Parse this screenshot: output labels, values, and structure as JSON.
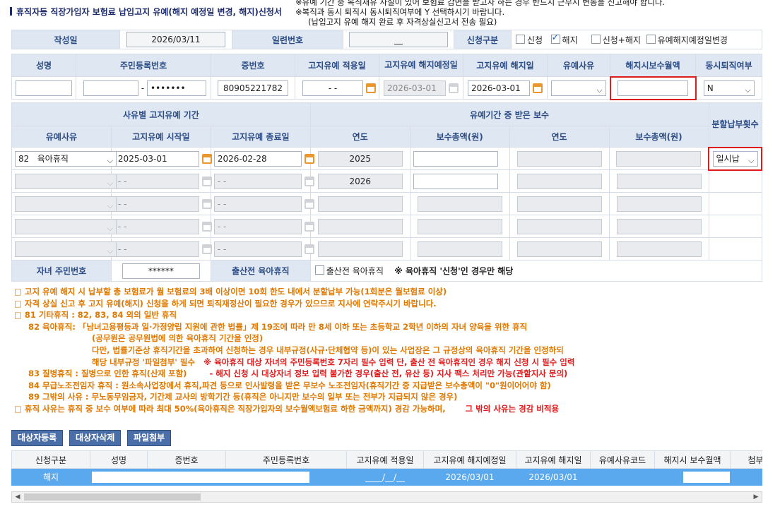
{
  "header": {
    "title": "휴직자등 직장가입자 보험료 납입고지 유예(해지 예정일 변경, 해지)신청서",
    "note1": "※유예 기간 중 복직재유 사실이 있어 보험료 감면을 받고자 하는 경우 반드시 근무시 변동을 신고해야 합니다.",
    "note2": "※복직과 동시 퇴직시 동시퇴직여부에 Y 선택하시기 바랍니다.",
    "note3": "(납입고지 유예 해지 완료 후 자격상실신고서 전송 필요)"
  },
  "row1": {
    "date_label": "작성일",
    "date_value": "2026/03/11",
    "serial_label": "일련번호",
    "serial_value": "__",
    "type_label": "신청구분",
    "opt1": "신청",
    "opt2": "해지",
    "opt3": "신청+해지",
    "opt4": "유예해지예정일변경"
  },
  "row2_headers": {
    "name": "성명",
    "rrn": "주민등록번호",
    "cert": "증번호",
    "apply_date": "고지유예 적용일",
    "cancel_sched": "고지유예 해지예정일",
    "cancel_date": "고지유예 해지일",
    "reason": "유예사유",
    "wage": "해지시보수월액",
    "sim_retire": "동시퇴직여부"
  },
  "row2_values": {
    "rrn_back": "•••••••",
    "cert_no": "80905221782",
    "apply_date": "- -",
    "cancel_sched": "2026-03-01",
    "cancel_date": "2026-03-01",
    "sim_retire": "N"
  },
  "period": {
    "section_title": "사유별 고지유예 기간",
    "pay_title": "유예기간 중 받은 보수",
    "install_title": "분할납부횟수",
    "h_reason": "유예사유",
    "h_start": "고지유예 시작일",
    "h_end": "고지유예 종료일",
    "h_year": "연도",
    "h_total": "보수총액(원)",
    "row1_code": "82",
    "row1_reason": "육아휴직",
    "row1_start": "2025-03-01",
    "row1_end": "2026-02-28",
    "row1_year": "2025",
    "row2_year": "2026",
    "empty_date": "- -",
    "install_value": "일시납"
  },
  "child": {
    "label": "자녀 주민번호",
    "value": "******",
    "prenatal_label": "출산전 육아휴직",
    "prenatal_check": "출산전 육아휴직",
    "prenatal_note": "※ 육아휴직 '신청'인 경우만 해당"
  },
  "notes": {
    "n1": "□ 고지 유예 해지 시 납부할 총 보험료가 월 보험료의 3배 이상이면 10회 한도 내에서 분할납부 가능(1회분은 월보험료 이상)",
    "n2": "□ 자격 상실 신고 후 고지 유예(해지) 신청을 하게 되면 퇴직재정산이 필요한 경우가 있으므로 지사에 연락주시기 바랍니다.",
    "n3": "□ 81 기타휴직 : 82, 83, 84 외의 일반 휴직",
    "n4": "82 육아휴직: 「남녀고용평등과 일·가정양립 지원에 관한 법률」제 19조에 따라 만 8세 이하 또는 초등학교 2학년 이하의 자녀 양육을 위한 휴직",
    "n5": "(공무원은 공무원법에 의한 육아휴직 기간을 인정)",
    "n6": "다만, 법률기준상 휴직기간을 초과하여 신청하는 경우 내부규정(사규·단체협약 등)이 있는 사업장은 그 규정상의 육아휴직 기간을 인정하되",
    "n7": "해당 내부규정 '파일첨부' 필수",
    "n7_red": "※ 육아휴직 대상 자녀의 주민등록번호 7자리 필수 입력 단, 출산 전 육아휴직인 경우 해지 신청 시 필수 입력",
    "n8": "83 질병휴직 : 질병으로 인한 휴직(산재 포함)",
    "n8_red": "- 해지 신청 시 대상자녀 정보 입력 불가한 경우(출산 전, 유산 등) 지사 팩스 처리만 가능(관할지사 문의)",
    "n9": "84 무급노조전임자 휴직 : 원소속사업장에서 휴직,파견 등으로 인사발령을 받은 무보수 노조전임자(휴직기간 중 지급받은 보수총액이 \"0\"원이어어야 함)",
    "n10": "89 그밖의 사유 : 무노동무임금자, 기간제 교사의 방학기간 등(휴직은 아니지만 보수의 일부 또는 전부가 지급되지 않은 경우)",
    "n11": "□ 휴직 사유는 휴직 중 보수 여부에 따라 최대 50%(육아휴직은 직장가입자의 보수월액보험료 하한 금액까지) 경감 가능하며,",
    "n11_red": "그 밖의 사유는 경감 비적용"
  },
  "buttons": {
    "register": "대상자등록",
    "delete": "대상자삭제",
    "attach": "파일첨부"
  },
  "grid": {
    "headers": [
      "신청구분",
      "성명",
      "증번호",
      "주민등록번호",
      "고지유예 적용일",
      "고지유예 해지예정일",
      "고지유예 해지일",
      "유예사유코드",
      "해지시 보수월액",
      "첨부"
    ],
    "row": {
      "type": "해지",
      "apply": "____/__/__",
      "sched": "2026/03/01",
      "cancel": "2026/03/01"
    }
  },
  "colors": {
    "label_bg": "#dfe7f2",
    "label_text": "#2c4c86",
    "highlight": "#e01b1b",
    "row_selected": "#5aa9ef"
  }
}
